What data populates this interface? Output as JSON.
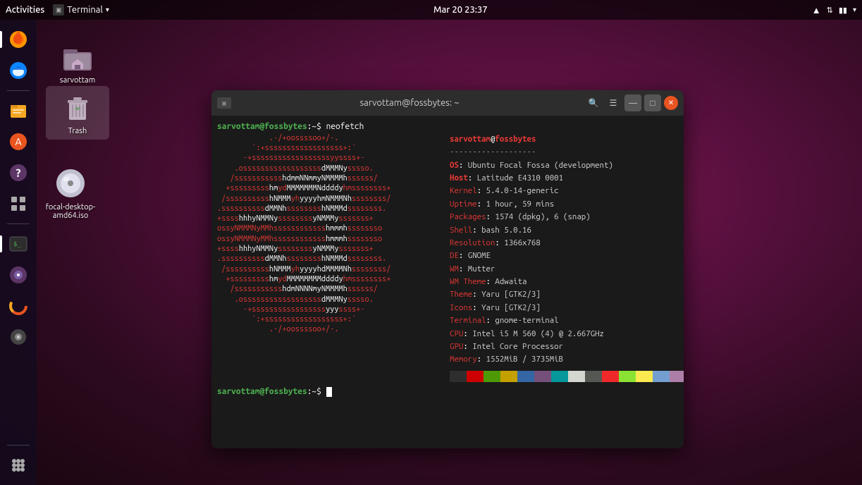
{
  "topbar": {
    "activities": "Activities",
    "terminal_label": "Terminal",
    "datetime": "Mar 20  23:37",
    "chevron": "▾"
  },
  "desktop": {
    "icons": [
      {
        "id": "sarvottam-home",
        "label": "sarvottam",
        "type": "home"
      },
      {
        "id": "trash",
        "label": "Trash",
        "type": "trash"
      },
      {
        "id": "focal-iso",
        "label": "focal-desktop-amd64.iso",
        "type": "iso"
      }
    ]
  },
  "terminal": {
    "title": "sarvottam@fossbytes: ~",
    "prompt_user": "sarvottam",
    "prompt_host": "fossbytes",
    "command": "neofetch",
    "neofetch": {
      "user_host": "sarvottam@fossbytes",
      "separator": "-------------------",
      "os_label": "OS",
      "os_val": "Ubuntu Focal Fossa (development)",
      "host_label": "Host",
      "host_val": "Latitude E4310 0001",
      "kernel_label": "Kernel",
      "kernel_val": "5.4.0-14-generic",
      "uptime_label": "Uptime",
      "uptime_val": "1 hour, 59 mins",
      "packages_label": "Packages",
      "packages_val": "1574 (dpkg), 6 (snap)",
      "shell_label": "Shell",
      "shell_val": "bash 5.0.16",
      "resolution_label": "Resolution",
      "resolution_val": "1366x768",
      "de_label": "DE",
      "de_val": "GNOME",
      "wm_label": "WM",
      "wm_val": "Mutter",
      "wm_theme_label": "WM Theme",
      "wm_theme_val": "Adwaita",
      "theme_label": "Theme",
      "theme_val": "Yaru [GTK2/3]",
      "icons_label": "Icons",
      "icons_val": "Yaru [GTK2/3]",
      "terminal_label": "Terminal",
      "terminal_val": "gnome-terminal",
      "cpu_label": "CPU",
      "cpu_val": "Intel i5 M 560 (4) @ 2.667GHz",
      "gpu_label": "GPU",
      "gpu_val": "Intel Core Processor",
      "memory_label": "Memory",
      "memory_val": "1552MiB / 3735MiB"
    },
    "prompt2_user": "sarvottam",
    "prompt2_host": "fossbytes",
    "color_blocks": [
      "#2e2e2e",
      "#cc0000",
      "#4e9a06",
      "#c4a000",
      "#3465a4",
      "#75507b",
      "#06989a",
      "#d3d7cf",
      "#555753",
      "#ef2929",
      "#8ae234",
      "#fce94f",
      "#729fcf",
      "#ad7fa8",
      "#34e2e2",
      "#eeeeec"
    ]
  },
  "sidebar": {
    "apps": [
      "firefox",
      "thunderbird",
      "files",
      "software-center",
      "help",
      "app-grid",
      "terminal-app",
      "rhythmbox",
      "disk-usage",
      "disk-utility"
    ],
    "grid_label": "⋯"
  }
}
